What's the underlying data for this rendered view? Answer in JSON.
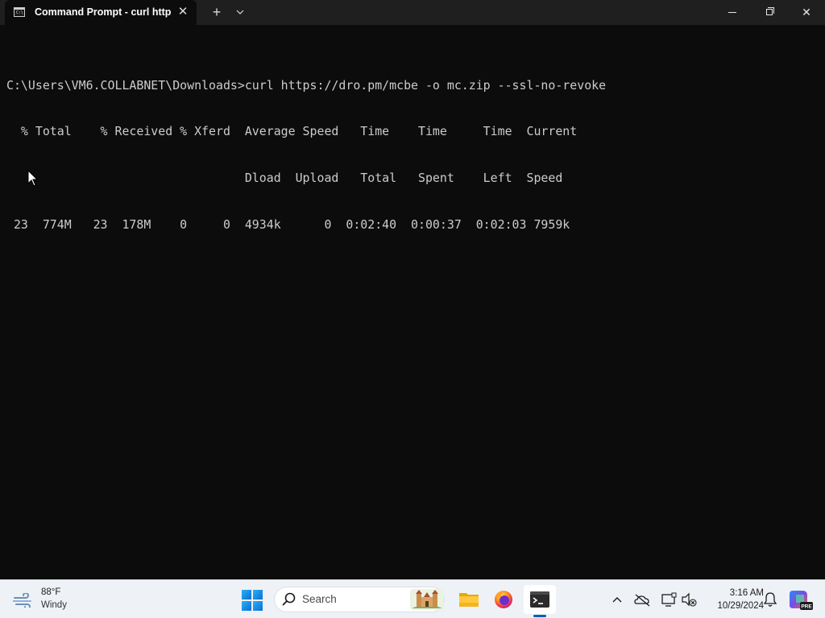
{
  "window": {
    "tab_title": "Command Prompt - curl  http",
    "tab_icon_glyph": "C:\\",
    "close_tab_glyph": "✕",
    "new_tab_glyph": "+",
    "dropdown_glyph": "⌄",
    "close_glyph": "✕"
  },
  "terminal": {
    "lines": [
      "C:\\Users\\VM6.COLLABNET\\Downloads>curl https://dro.pm/mcbe -o mc.zip --ssl-no-revoke",
      "  % Total    % Received % Xferd  Average Speed   Time    Time     Time  Current",
      "                                 Dload  Upload   Total   Spent    Left  Speed",
      " 23  774M   23  178M    0     0  4934k      0  0:02:40  0:00:37  0:02:03 7959k"
    ]
  },
  "taskbar": {
    "weather_temp": "88°F",
    "weather_condition": "Windy",
    "search_placeholder": "Search",
    "clock_time": "3:16 AM",
    "clock_date": "10/29/2024",
    "copilot_badge": "PRE"
  },
  "icons": {
    "start": "windows-start-icon",
    "search": "search-icon",
    "explorer": "file-explorer-icon",
    "firefox": "firefox-icon",
    "terminal": "terminal-icon",
    "onedrive": "onedrive-offline-icon",
    "display": "display-icon",
    "volume": "volume-muted-icon",
    "bell": "notification-bell-icon",
    "copilot": "copilot-icon"
  },
  "colors": {
    "terminal_bg": "#0c0c0c",
    "terminal_fg": "#cccccc",
    "tabbar_bg": "#1f1f1f",
    "taskbar_bg": "#eef2f6",
    "accent": "#005fb8"
  }
}
